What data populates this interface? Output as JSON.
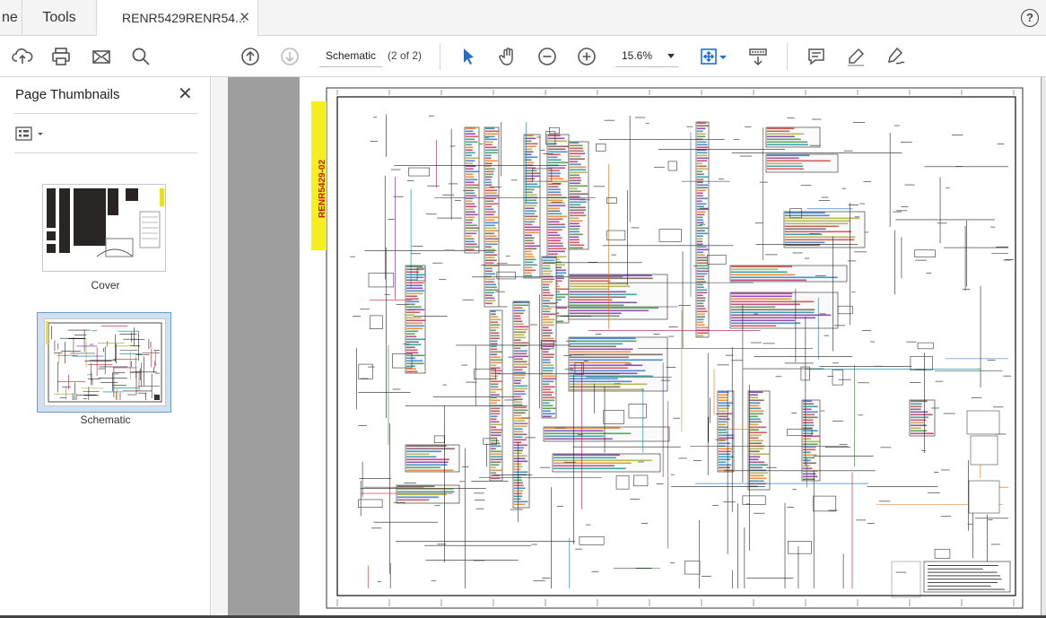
{
  "tabs": {
    "home_label": "ne",
    "tools_label": "Tools",
    "document_label": "RENR5429RENR54...",
    "close_glyph": "✕",
    "help_glyph": "?"
  },
  "toolbar": {
    "page_label": "Schematic",
    "page_count": "(2 of 2)",
    "zoom_value": "15.6%"
  },
  "sidebar": {
    "title": "Page Thumbnails",
    "close_glyph": "✕",
    "thumbnails": [
      {
        "label": "Cover"
      },
      {
        "label": "Schematic"
      }
    ]
  },
  "document": {
    "title_strip_text": "RENR5429-02",
    "accent_colors": {
      "strip": "#f7ee1f",
      "strip_text": "#cc1a1a",
      "selection": "#6a9ccf"
    }
  }
}
